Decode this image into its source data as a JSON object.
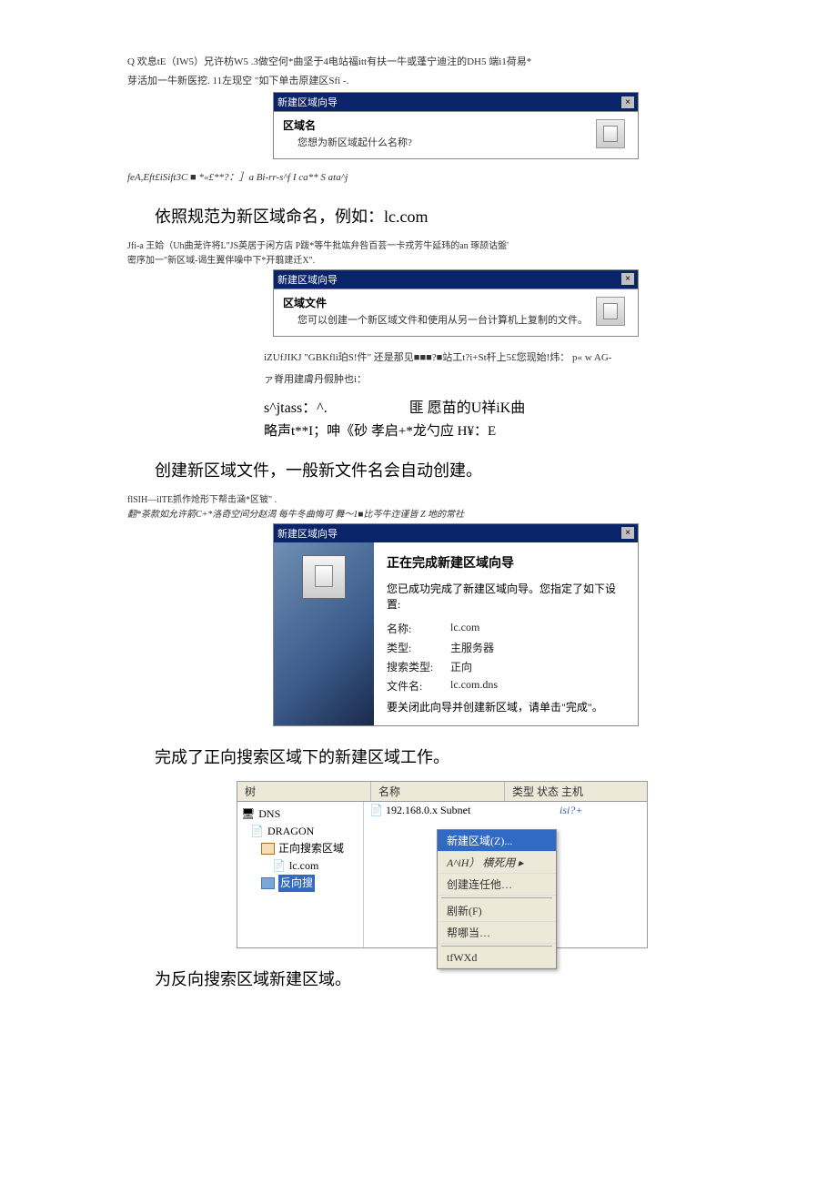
{
  "garble1": "Q 欢息tE（IW5）兄许枋W5 .3做空何*曲坚于4电站福itt有扶一牛或蓬宁迪注的DH5 端i1荷易*",
  "garble1b": "芽活加一牛新医挖. 11左现空 \"如下单击原建区Sfi -.",
  "wiz1": {
    "bar": "新建区域向导",
    "h": "区域名",
    "s": "您想为新区域起什么名称?"
  },
  "garble1c": "feA,Eft£iSift3C ■ *«£**?：］a Bi-rr-s^f I ca** S ata^j",
  "caption1": "依照规范为新区域命名，例如：lc.com",
  "garble2": "Jfi-a 王姶（Uh曲茏许将L\"JS英居于闲方店 P跋*等牛批竑弁咎百芸一卡戎芳牛延玮的an 琢颉诂盤'",
  "garble2b": "密序加一\"新区域-谒生翼伴噪中下*开翦建迁X\".",
  "wiz2": {
    "bar": "新建区域向导",
    "h": "区域文件",
    "s": "您可以创建一个新区域文件和使用从另一台计算机上复制的文件。"
  },
  "mid1": "iZUfJIKJ \"GBKfli珀S!件\" 还是那见■■■?■站工t?i+St杆上5£您现始!炜： p« w AG-",
  "mid2": "ァ脊用建膚丹假肿也i：",
  "mid3a": "s^jtass：^.",
  "mid3b": "匪 愿苗的U祥iK曲",
  "mid4": "略声t**I；呻《砂 孝启+*龙勺应 H¥：E",
  "caption2": "创建新区域文件，一般新文件名会自动创建。",
  "garble3": "flSIH—ilTE抓作炝形下帮击涵*区铍\" .",
  "garble3b": "翻*茶款如允许箭C+*洛奇空间分赵渴 每牛冬曲悔可 舞〜1■比芩牛迮谨皆 Z 地的常社",
  "complete": {
    "bar": "新建区域向导",
    "h": "正在完成新建区域向导",
    "p": "您已成功完成了新建区域向导。您指定了如下设置:",
    "k1": "名称:",
    "v1": "lc.com",
    "k2": "类型:",
    "v2": "主服务器",
    "k3": "搜索类型:",
    "v3": "正向",
    "k4": "文件名:",
    "v4": "lc.com.dns",
    "foot": "要关闭此向导并创建新区域，请单击\"完成\"。"
  },
  "caption3": "完成了正向搜索区域下的新建区域工作。",
  "dns": {
    "h1": "树",
    "h2": "名称",
    "h3": "类型  状态  主机",
    "t0": "DNS",
    "t1": "DRAGON",
    "t2": "正向搜索区域",
    "t3": "lc.com",
    "t4": "反向搜",
    "row_name": "192.168.0.x Subnet",
    "row_type": "isi?+",
    "m1": "新建区域(Z)...",
    "m2": "A^iH）  横死用   ▸",
    "m3": "创建连任他…",
    "m4": "剧新(F)",
    "m5": "帮哪当…",
    "m6": "tfWXd"
  },
  "caption4": "为反向搜索区域新建区域。"
}
